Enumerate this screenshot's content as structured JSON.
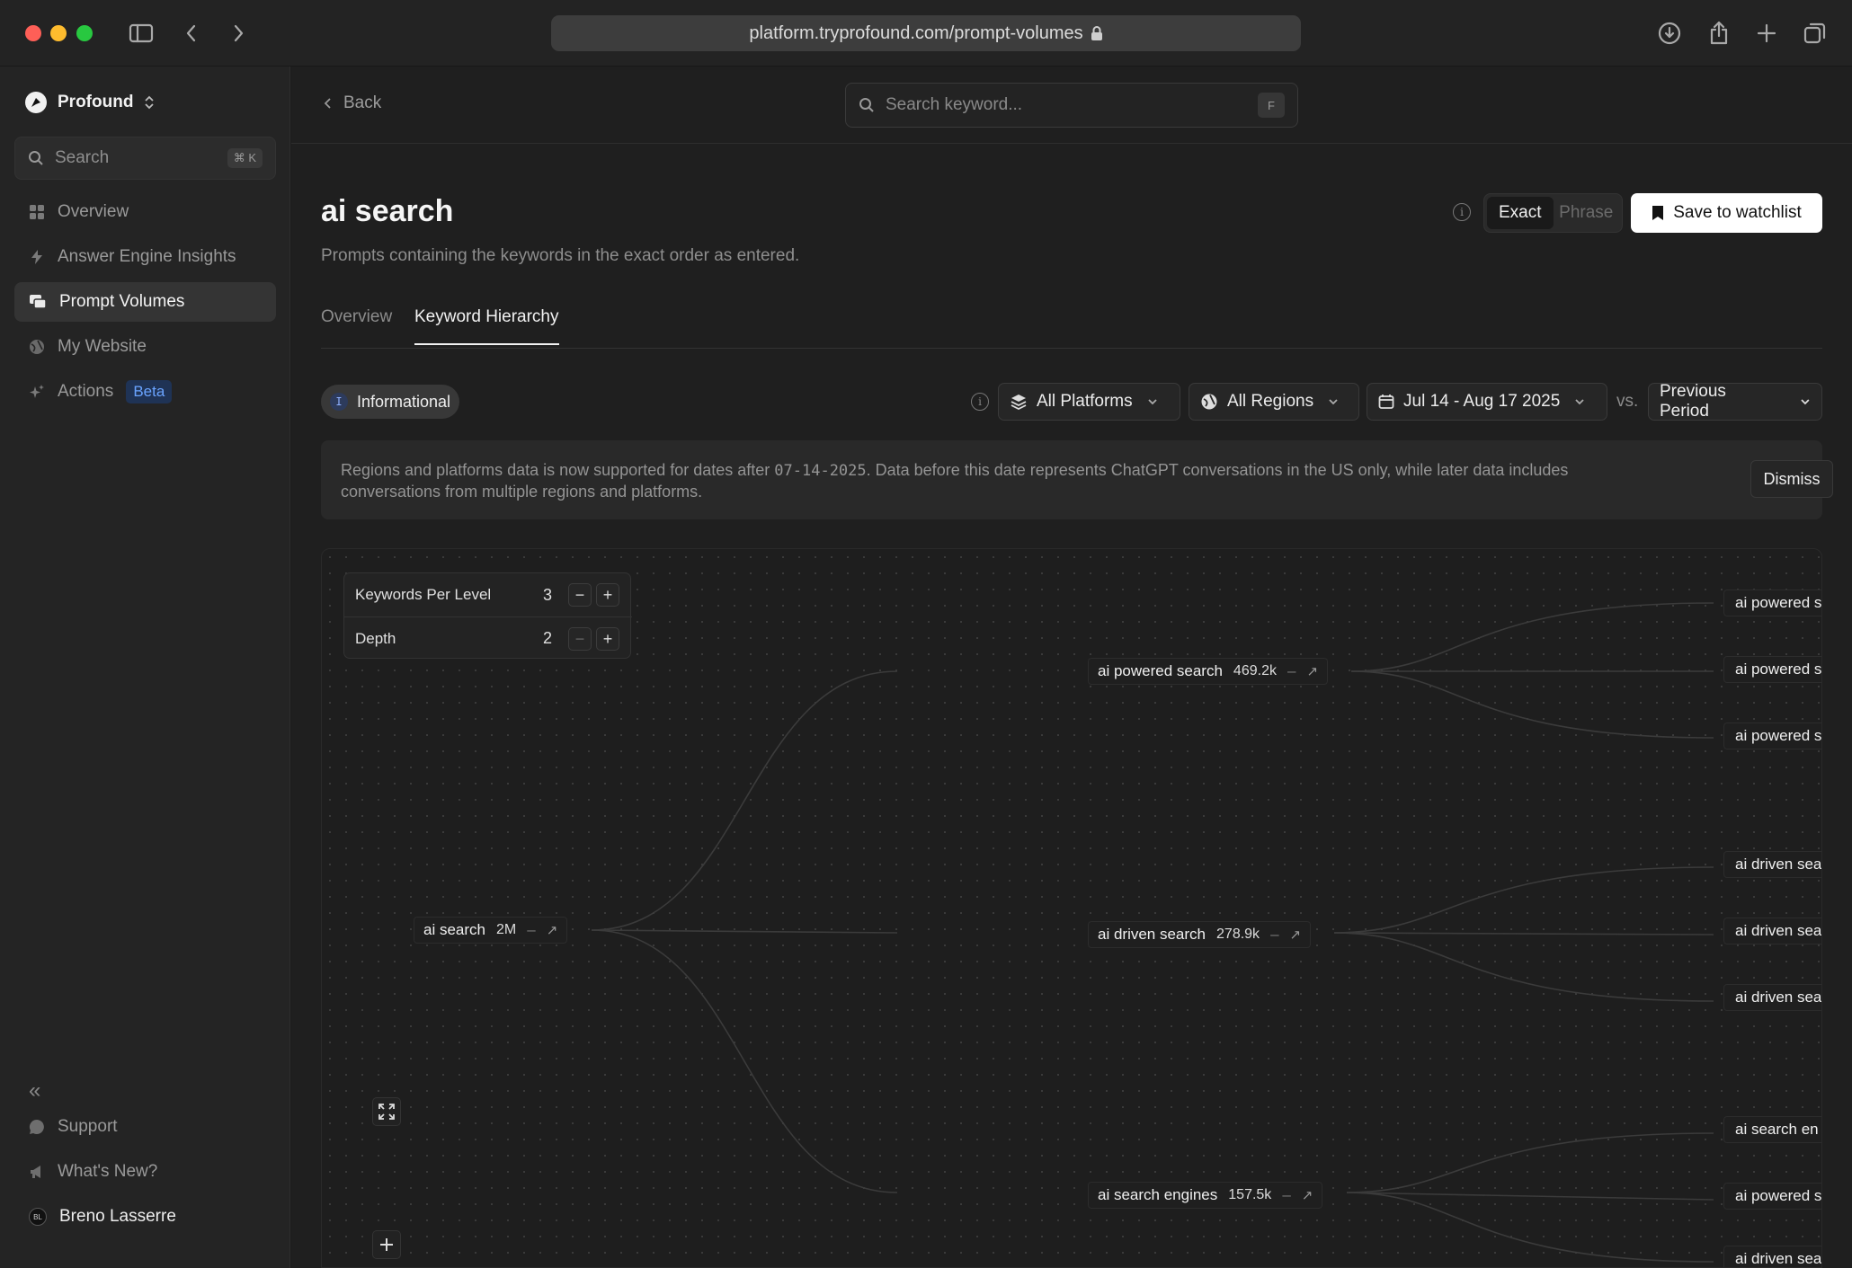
{
  "browser": {
    "url": "platform.tryprofound.com/prompt-volumes"
  },
  "sidebar": {
    "workspace": "Profound",
    "search_label": "Search",
    "search_shortcut": "⌘ K",
    "items": [
      {
        "label": "Overview",
        "icon": "grid-icon"
      },
      {
        "label": "Answer Engine Insights",
        "icon": "bolt-icon"
      },
      {
        "label": "Prompt Volumes",
        "icon": "chat-bubbles-icon",
        "active": true
      },
      {
        "label": "My Website",
        "icon": "globe-icon"
      },
      {
        "label": "Actions",
        "icon": "sparkle-icon",
        "badge": "Beta"
      }
    ],
    "collapse_glyph": "«",
    "footer": [
      {
        "label": "Support",
        "icon": "chat-icon"
      },
      {
        "label": "What's New?",
        "icon": "megaphone-icon"
      }
    ],
    "user": {
      "name": "Breno Lasserre",
      "initials": "BL"
    }
  },
  "topbar": {
    "back_label": "Back",
    "search_placeholder": "Search keyword...",
    "search_shortcut": "F"
  },
  "page": {
    "title": "ai search",
    "subtitle": "Prompts containing the keywords in the exact order as entered.",
    "match_modes": [
      "Exact",
      "Phrase"
    ],
    "active_mode": "Exact",
    "save_label": "Save to watchlist",
    "tabs": [
      "Overview",
      "Keyword Hierarchy"
    ],
    "active_tab": "Keyword Hierarchy"
  },
  "filters": {
    "intent_badge": "I",
    "intent_label": "Informational",
    "platform": "All Platforms",
    "region": "All Regions",
    "date_range": "Jul 14 - Aug 17 2025",
    "vs_label": "vs.",
    "comparison": "Previous Period"
  },
  "notice": {
    "text_before": "Regions and platforms data is now supported for dates after ",
    "date_code": "07-14-2025",
    "text_after": ". Data before this date represents ChatGPT conversations in the US only, while later data includes conversations from multiple regions and platforms.",
    "dismiss_label": "Dismiss"
  },
  "hierarchy_controls": {
    "keywords_per_level_label": "Keywords Per Level",
    "keywords_per_level": "3",
    "depth_label": "Depth",
    "depth": "2",
    "minus": "−",
    "plus": "+"
  },
  "tree": {
    "root": {
      "keyword": "ai search",
      "volume": "2M",
      "change": "–"
    },
    "level1": [
      {
        "keyword": "ai powered search",
        "volume": "469.2k",
        "change": "–"
      },
      {
        "keyword": "ai driven search",
        "volume": "278.9k",
        "change": "–"
      },
      {
        "keyword": "ai search engines",
        "volume": "157.5k",
        "change": "–"
      }
    ],
    "level2": [
      "ai powered s",
      "ai powered s",
      "ai powered s",
      "ai driven sea",
      "ai driven sea",
      "ai driven sea",
      "ai search en",
      "ai powered s",
      "ai driven sea"
    ]
  }
}
